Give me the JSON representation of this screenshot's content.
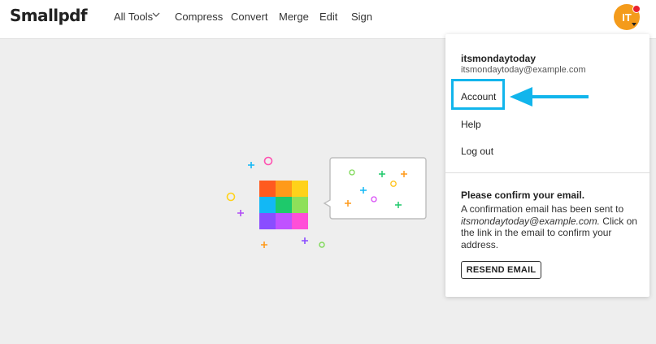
{
  "header": {
    "logo": "Smallpdf",
    "nav": {
      "all_tools": "All Tools",
      "compress": "Compress",
      "convert": "Convert",
      "merge": "Merge",
      "edit": "Edit",
      "sign": "Sign"
    },
    "avatar_initials": "IT"
  },
  "dropdown": {
    "username": "itsmondaytoday",
    "email": "itsmondaytoday@example.com",
    "items": {
      "account": "Account",
      "help": "Help",
      "logout": "Log out"
    },
    "confirm": {
      "title": "Please confirm your email.",
      "body_prefix": "A confirmation email has been sent to",
      "body_email": "itsmondaytoday@example.com.",
      "body_suffix": "Click on the link in the email to confirm your address.",
      "button": "RESEND EMAIL"
    }
  },
  "colors": {
    "avatar": "#f49b1b",
    "notification": "#e8222f",
    "highlight": "#11b5ec",
    "grid": [
      "#ff5a1f",
      "#ff9a1a",
      "#ffd21a",
      "#12b8f5",
      "#1ec96b",
      "#8ee05a",
      "#8a4dff",
      "#c052ff",
      "#ff4fd8"
    ]
  },
  "icons": [
    "chevron-down-icon",
    "notification-dot-icon",
    "caret-down-icon",
    "arrow-left-icon"
  ]
}
